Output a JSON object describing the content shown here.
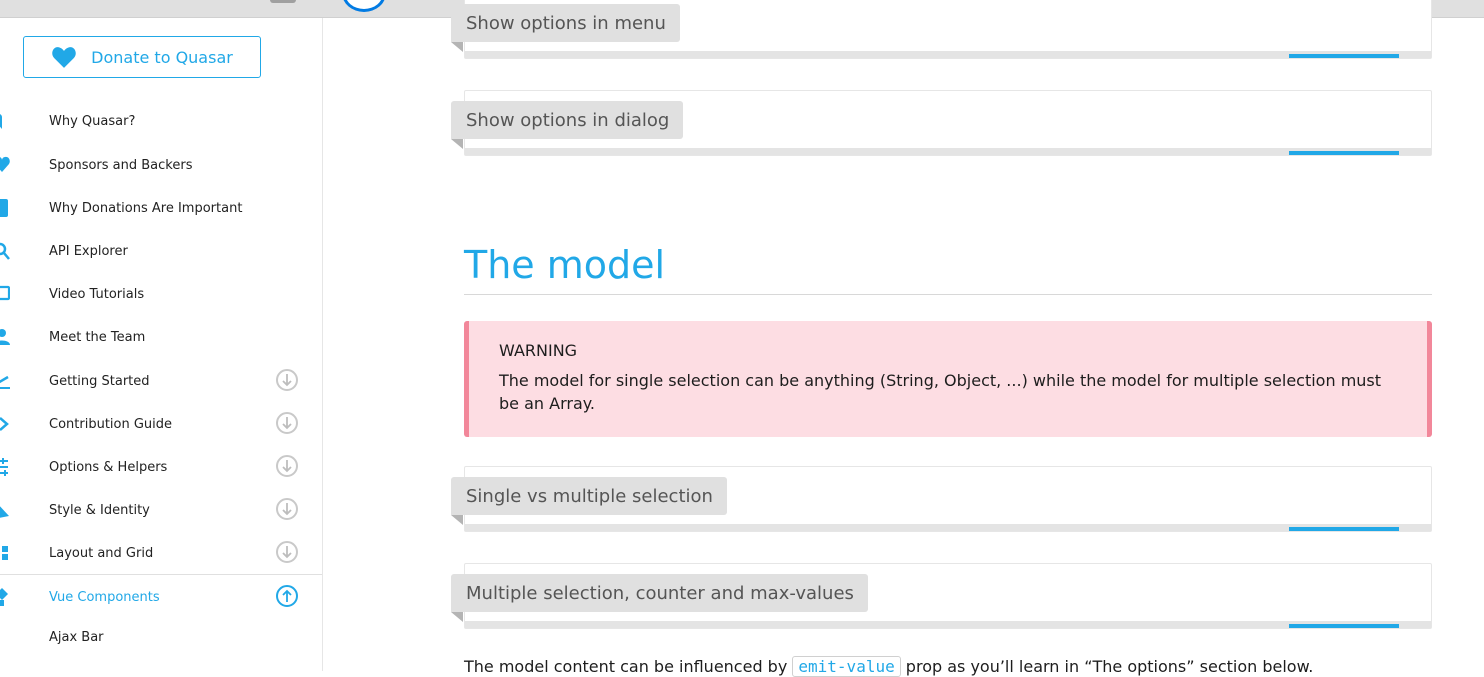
{
  "sidebar": {
    "donate_label": "Donate to Quasar",
    "items": [
      {
        "label": "Why Quasar?",
        "icon": "heart-icon"
      },
      {
        "label": "Sponsors and Backers",
        "icon": "heart-icon"
      },
      {
        "label": "Why Donations Are Important",
        "icon": "shield-icon"
      },
      {
        "label": "API Explorer",
        "icon": "search-icon"
      },
      {
        "label": "Video Tutorials",
        "icon": "video-icon"
      },
      {
        "label": "Meet the Team",
        "icon": "people-icon"
      },
      {
        "label": "Getting Started",
        "icon": "flight-icon",
        "expand": "down"
      },
      {
        "label": "Contribution Guide",
        "icon": "code-icon",
        "expand": "down"
      },
      {
        "label": "Options & Helpers",
        "icon": "tune-icon",
        "expand": "down"
      },
      {
        "label": "Style & Identity",
        "icon": "style-icon",
        "expand": "down"
      },
      {
        "label": "Layout and Grid",
        "icon": "grid-icon",
        "expand": "down"
      },
      {
        "label": "Vue Components",
        "icon": "widgets-icon",
        "expand": "up",
        "active": true
      },
      {
        "label": "Ajax Bar",
        "icon": ""
      }
    ]
  },
  "main": {
    "cards": [
      {
        "label": "Show options in menu"
      },
      {
        "label": "Show options in dialog"
      },
      {
        "label": "Single vs multiple selection"
      },
      {
        "label": "Multiple selection, counter and max-values"
      }
    ],
    "section_title": "The model",
    "warning": {
      "title": "WARNING",
      "text": "The model for single selection can be anything (String, Object, ...) while the model for multiple selection must be an Array."
    },
    "paragraph": {
      "before": "The model content can be influenced by ",
      "code": "emit-value",
      "after": " prop as you’ll learn in “The options” section below."
    }
  },
  "colors": {
    "accent": "#21a8e7",
    "warning_bg": "#fddde3",
    "warning_border": "#f2879a"
  }
}
